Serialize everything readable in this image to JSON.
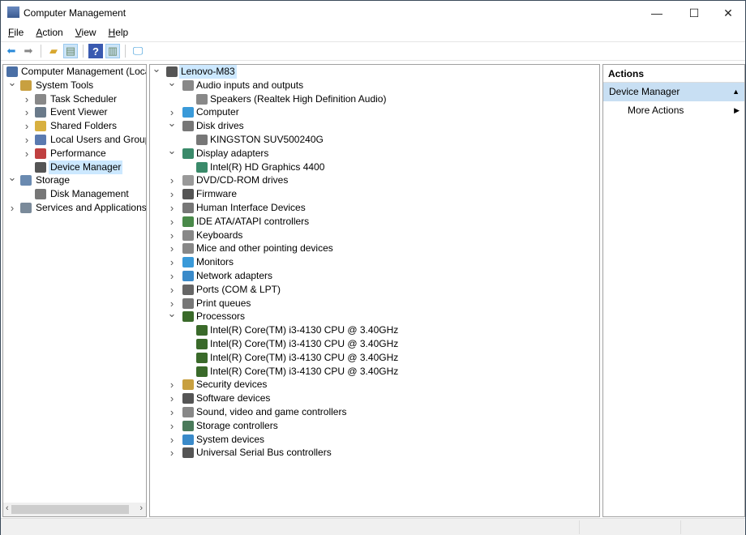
{
  "window": {
    "title": "Computer Management",
    "minimize": "—",
    "maximize": "☐",
    "close": "✕"
  },
  "menu": [
    "File",
    "Action",
    "View",
    "Help"
  ],
  "left_tree": [
    {
      "label": "Computer Management (Local",
      "level": 0,
      "chev": "",
      "color": "#4a6fa5"
    },
    {
      "label": "System Tools",
      "level": 1,
      "chev": "v",
      "color": "#c8a040"
    },
    {
      "label": "Task Scheduler",
      "level": 2,
      "chev": ">",
      "color": "#888"
    },
    {
      "label": "Event Viewer",
      "level": 2,
      "chev": ">",
      "color": "#6a7a8a"
    },
    {
      "label": "Shared Folders",
      "level": 2,
      "chev": ">",
      "color": "#d8b040"
    },
    {
      "label": "Local Users and Groups",
      "level": 2,
      "chev": ">",
      "color": "#5a7ab0"
    },
    {
      "label": "Performance",
      "level": 2,
      "chev": ">",
      "color": "#c04040"
    },
    {
      "label": "Device Manager",
      "level": 2,
      "chev": "",
      "color": "#555",
      "selected": true
    },
    {
      "label": "Storage",
      "level": 1,
      "chev": "v",
      "color": "#6a8ab0"
    },
    {
      "label": "Disk Management",
      "level": 2,
      "chev": "",
      "color": "#777"
    },
    {
      "label": "Services and Applications",
      "level": 1,
      "chev": ">",
      "color": "#7a8a9a"
    }
  ],
  "device_tree": [
    {
      "label": "Lenovo-M83",
      "level": 0,
      "chev": "v",
      "color": "#555",
      "selected": true
    },
    {
      "label": "Audio inputs and outputs",
      "level": 1,
      "chev": "v",
      "color": "#888"
    },
    {
      "label": "Speakers (Realtek High Definition Audio)",
      "level": 2,
      "color": "#888"
    },
    {
      "label": "Computer",
      "level": 1,
      "chev": ">",
      "color": "#3a9ad9"
    },
    {
      "label": "Disk drives",
      "level": 1,
      "chev": "v",
      "color": "#777"
    },
    {
      "label": "KINGSTON SUV500240G",
      "level": 2,
      "color": "#777"
    },
    {
      "label": "Display adapters",
      "level": 1,
      "chev": "v",
      "color": "#3a8a6a"
    },
    {
      "label": "Intel(R) HD Graphics 4400",
      "level": 2,
      "color": "#3a8a6a"
    },
    {
      "label": "DVD/CD-ROM drives",
      "level": 1,
      "chev": ">",
      "color": "#999"
    },
    {
      "label": "Firmware",
      "level": 1,
      "chev": ">",
      "color": "#555"
    },
    {
      "label": "Human Interface Devices",
      "level": 1,
      "chev": ">",
      "color": "#777"
    },
    {
      "label": "IDE ATA/ATAPI controllers",
      "level": 1,
      "chev": ">",
      "color": "#4a8a4a"
    },
    {
      "label": "Keyboards",
      "level": 1,
      "chev": ">",
      "color": "#888"
    },
    {
      "label": "Mice and other pointing devices",
      "level": 1,
      "chev": ">",
      "color": "#888"
    },
    {
      "label": "Monitors",
      "level": 1,
      "chev": ">",
      "color": "#3a9ad9"
    },
    {
      "label": "Network adapters",
      "level": 1,
      "chev": ">",
      "color": "#3a8ac9"
    },
    {
      "label": "Ports (COM & LPT)",
      "level": 1,
      "chev": ">",
      "color": "#666"
    },
    {
      "label": "Print queues",
      "level": 1,
      "chev": ">",
      "color": "#777"
    },
    {
      "label": "Processors",
      "level": 1,
      "chev": "v",
      "color": "#3a6a2a"
    },
    {
      "label": "Intel(R) Core(TM) i3-4130 CPU @ 3.40GHz",
      "level": 2,
      "color": "#3a6a2a"
    },
    {
      "label": "Intel(R) Core(TM) i3-4130 CPU @ 3.40GHz",
      "level": 2,
      "color": "#3a6a2a"
    },
    {
      "label": "Intel(R) Core(TM) i3-4130 CPU @ 3.40GHz",
      "level": 2,
      "color": "#3a6a2a"
    },
    {
      "label": "Intel(R) Core(TM) i3-4130 CPU @ 3.40GHz",
      "level": 2,
      "color": "#3a6a2a"
    },
    {
      "label": "Security devices",
      "level": 1,
      "chev": ">",
      "color": "#c8a040"
    },
    {
      "label": "Software devices",
      "level": 1,
      "chev": ">",
      "color": "#555"
    },
    {
      "label": "Sound, video and game controllers",
      "level": 1,
      "chev": ">",
      "color": "#888"
    },
    {
      "label": "Storage controllers",
      "level": 1,
      "chev": ">",
      "color": "#4a7a5a"
    },
    {
      "label": "System devices",
      "level": 1,
      "chev": ">",
      "color": "#3a8ac9"
    },
    {
      "label": "Universal Serial Bus controllers",
      "level": 1,
      "chev": ">",
      "color": "#555"
    }
  ],
  "actions": {
    "header": "Actions",
    "section": "Device Manager",
    "item": "More Actions"
  }
}
